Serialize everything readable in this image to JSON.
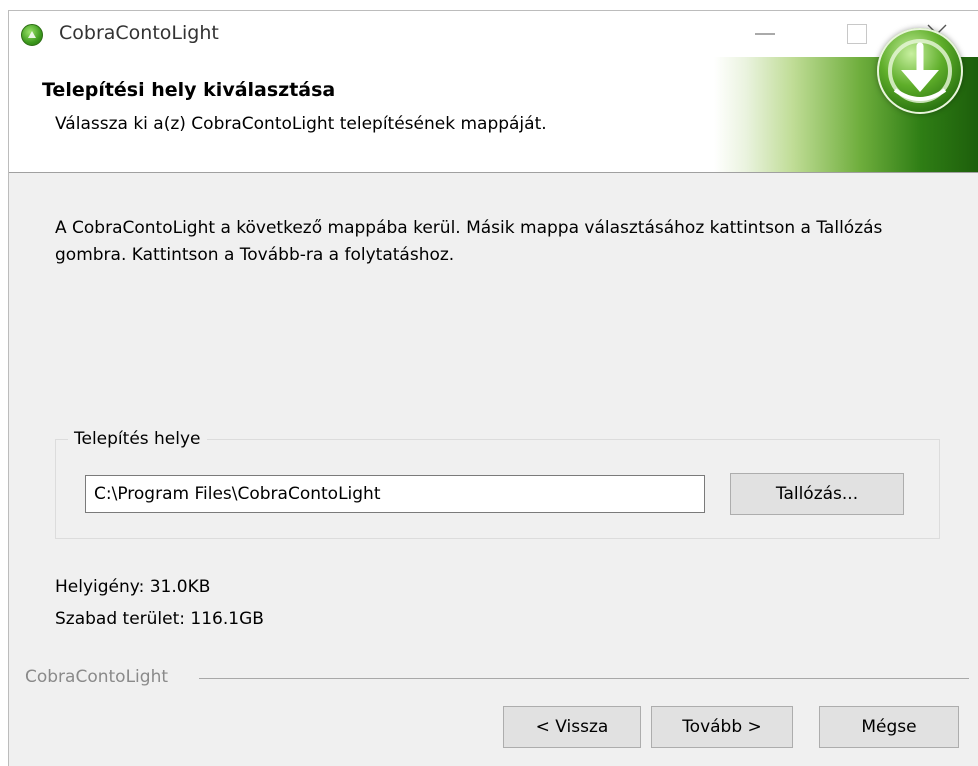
{
  "window": {
    "title": "CobraContoLight",
    "icon": "installer-icon"
  },
  "header": {
    "title": "Telepítési hely kiválasztása",
    "subtitle": "Válassza ki a(z) CobraContoLight telepítésének mappáját."
  },
  "main": {
    "description": "A CobraContoLight a következő mappába kerül. Másik mappa választásához kattintson a Tallózás gombra. Kattintson a Tovább-ra a folytatáshoz.",
    "group_label": "Telepítés helye",
    "install_path": "C:\\Program Files\\CobraContoLight",
    "browse_label": "Tallózás...",
    "space_required": "Helyigény: 31.0KB",
    "space_free": "Szabad terület: 116.1GB"
  },
  "footer": {
    "brand": "CobraContoLight",
    "back_label": "< Vissza",
    "next_label": "Tovább >",
    "cancel_label": "Mégse"
  },
  "colors": {
    "accent_green": "#2f7e15",
    "button_face": "#e1e1e1",
    "dialog_bg": "#f0f0f0"
  }
}
